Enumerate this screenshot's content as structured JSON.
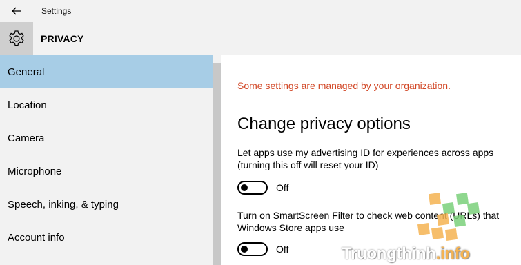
{
  "titlebar": {
    "back_icon": "back-arrow-icon",
    "title": "Settings"
  },
  "header": {
    "icon": "gear-icon",
    "title": "PRIVACY"
  },
  "sidebar": {
    "items": [
      {
        "label": "General",
        "selected": true
      },
      {
        "label": "Location",
        "selected": false
      },
      {
        "label": "Camera",
        "selected": false
      },
      {
        "label": "Microphone",
        "selected": false
      },
      {
        "label": "Speech, inking, & typing",
        "selected": false
      },
      {
        "label": "Account info",
        "selected": false
      }
    ]
  },
  "main": {
    "managed_note": "Some settings are managed by your organization.",
    "heading": "Change privacy options",
    "options": [
      {
        "text": "Let apps use my advertising ID for experiences across apps (turning this off will reset your ID)",
        "state": "Off"
      },
      {
        "text": "Turn on SmartScreen Filter to check web content (URLs) that Windows Store apps use",
        "state": "Off"
      }
    ]
  },
  "watermark": {
    "text_main": "Truongthinh",
    "text_suffix": ".info"
  },
  "colors": {
    "selected_bg": "#a7cde6",
    "managed_note": "#d24726",
    "chrome_bg": "#f2f2f2",
    "watermark_orange": "#f5b352",
    "watermark_green": "#7bd17b"
  }
}
